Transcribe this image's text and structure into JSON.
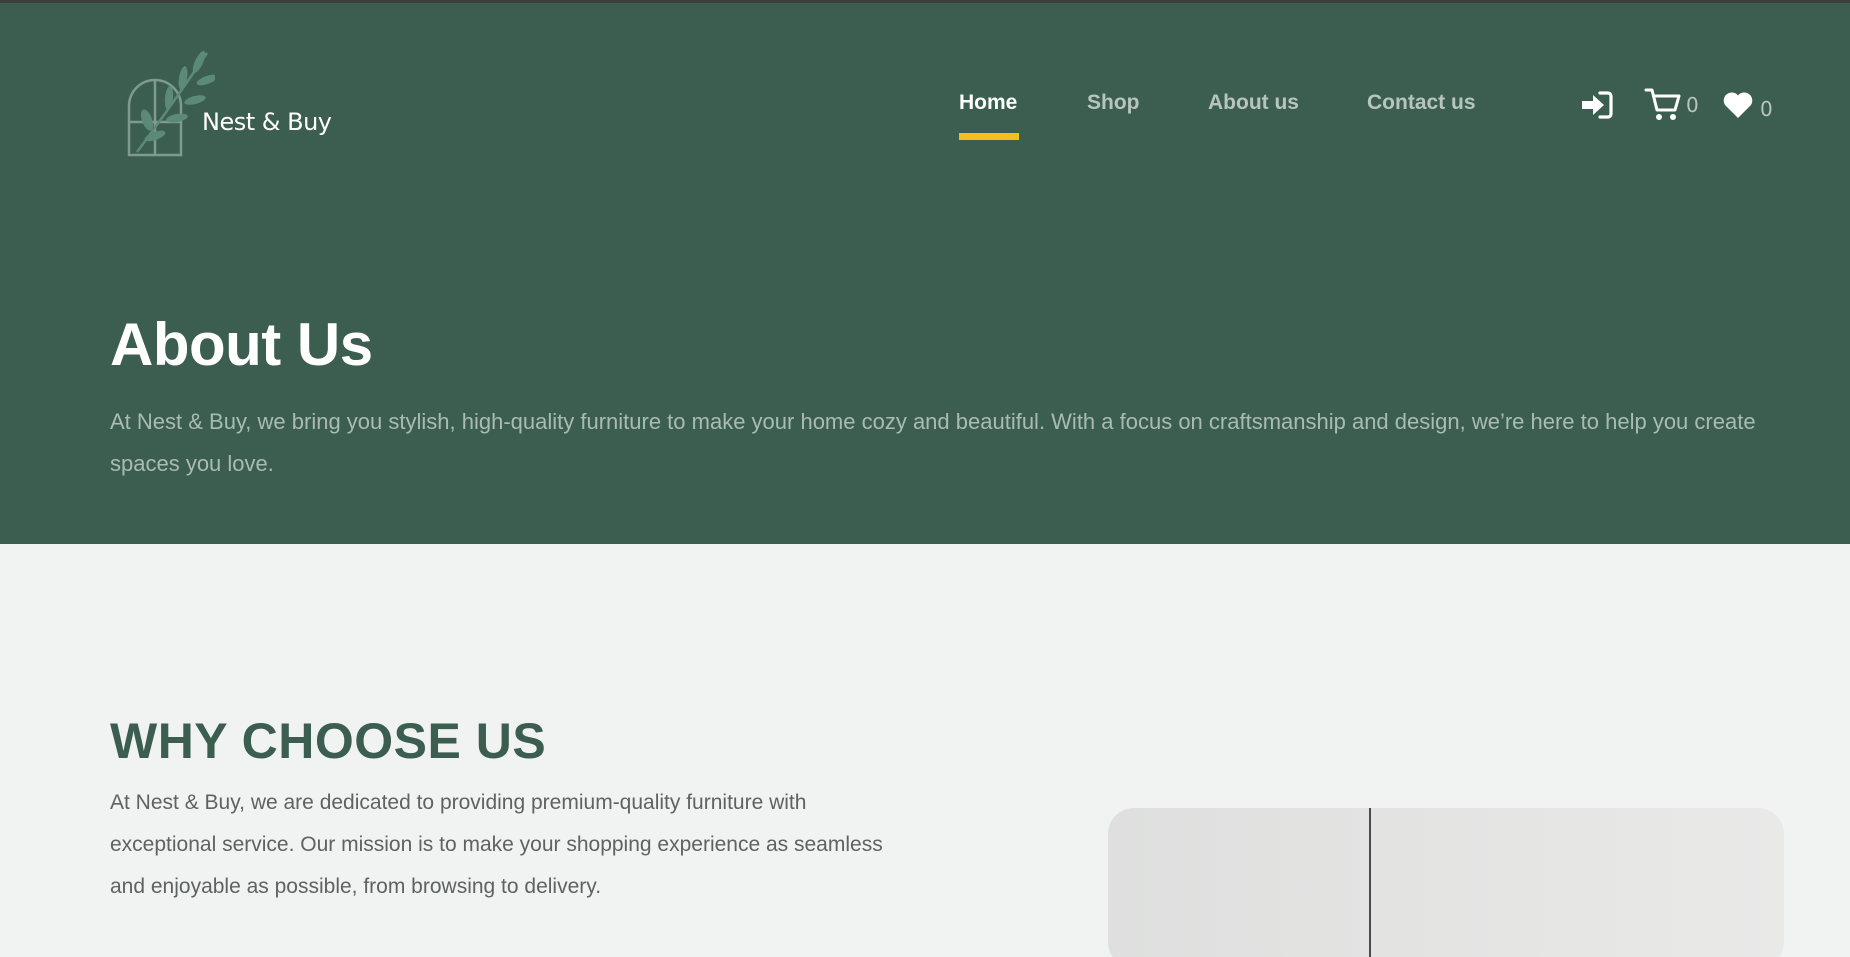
{
  "brand": {
    "name": "Nest & Buy"
  },
  "nav": {
    "items": [
      {
        "label": "Home",
        "active": true
      },
      {
        "label": "Shop",
        "active": false
      },
      {
        "label": "About us",
        "active": false
      },
      {
        "label": "Contact us",
        "active": false
      }
    ]
  },
  "header_icons": {
    "login": {
      "icon": "login-icon"
    },
    "cart": {
      "icon": "cart-icon",
      "count": "0"
    },
    "wishlist": {
      "icon": "heart-icon",
      "count": "0"
    }
  },
  "hero": {
    "title": "About Us",
    "text": "At Nest & Buy, we bring you stylish, high-quality furniture to make your home cozy and beautiful. With a focus on craftsmanship and design, we’re here to help you create spaces you love."
  },
  "why": {
    "title": "WHY CHOOSE US",
    "text": "At Nest & Buy, we are dedicated to providing premium-quality furniture with exceptional service. Our mission is to make your shopping experience as seamless and enjoyable as possible, from browsing to delivery."
  },
  "colors": {
    "hero_bg": "#3b5e50",
    "accent": "#f5bd1e",
    "page_bg": "#f1f3f2",
    "heading_green": "#3b5e50"
  }
}
